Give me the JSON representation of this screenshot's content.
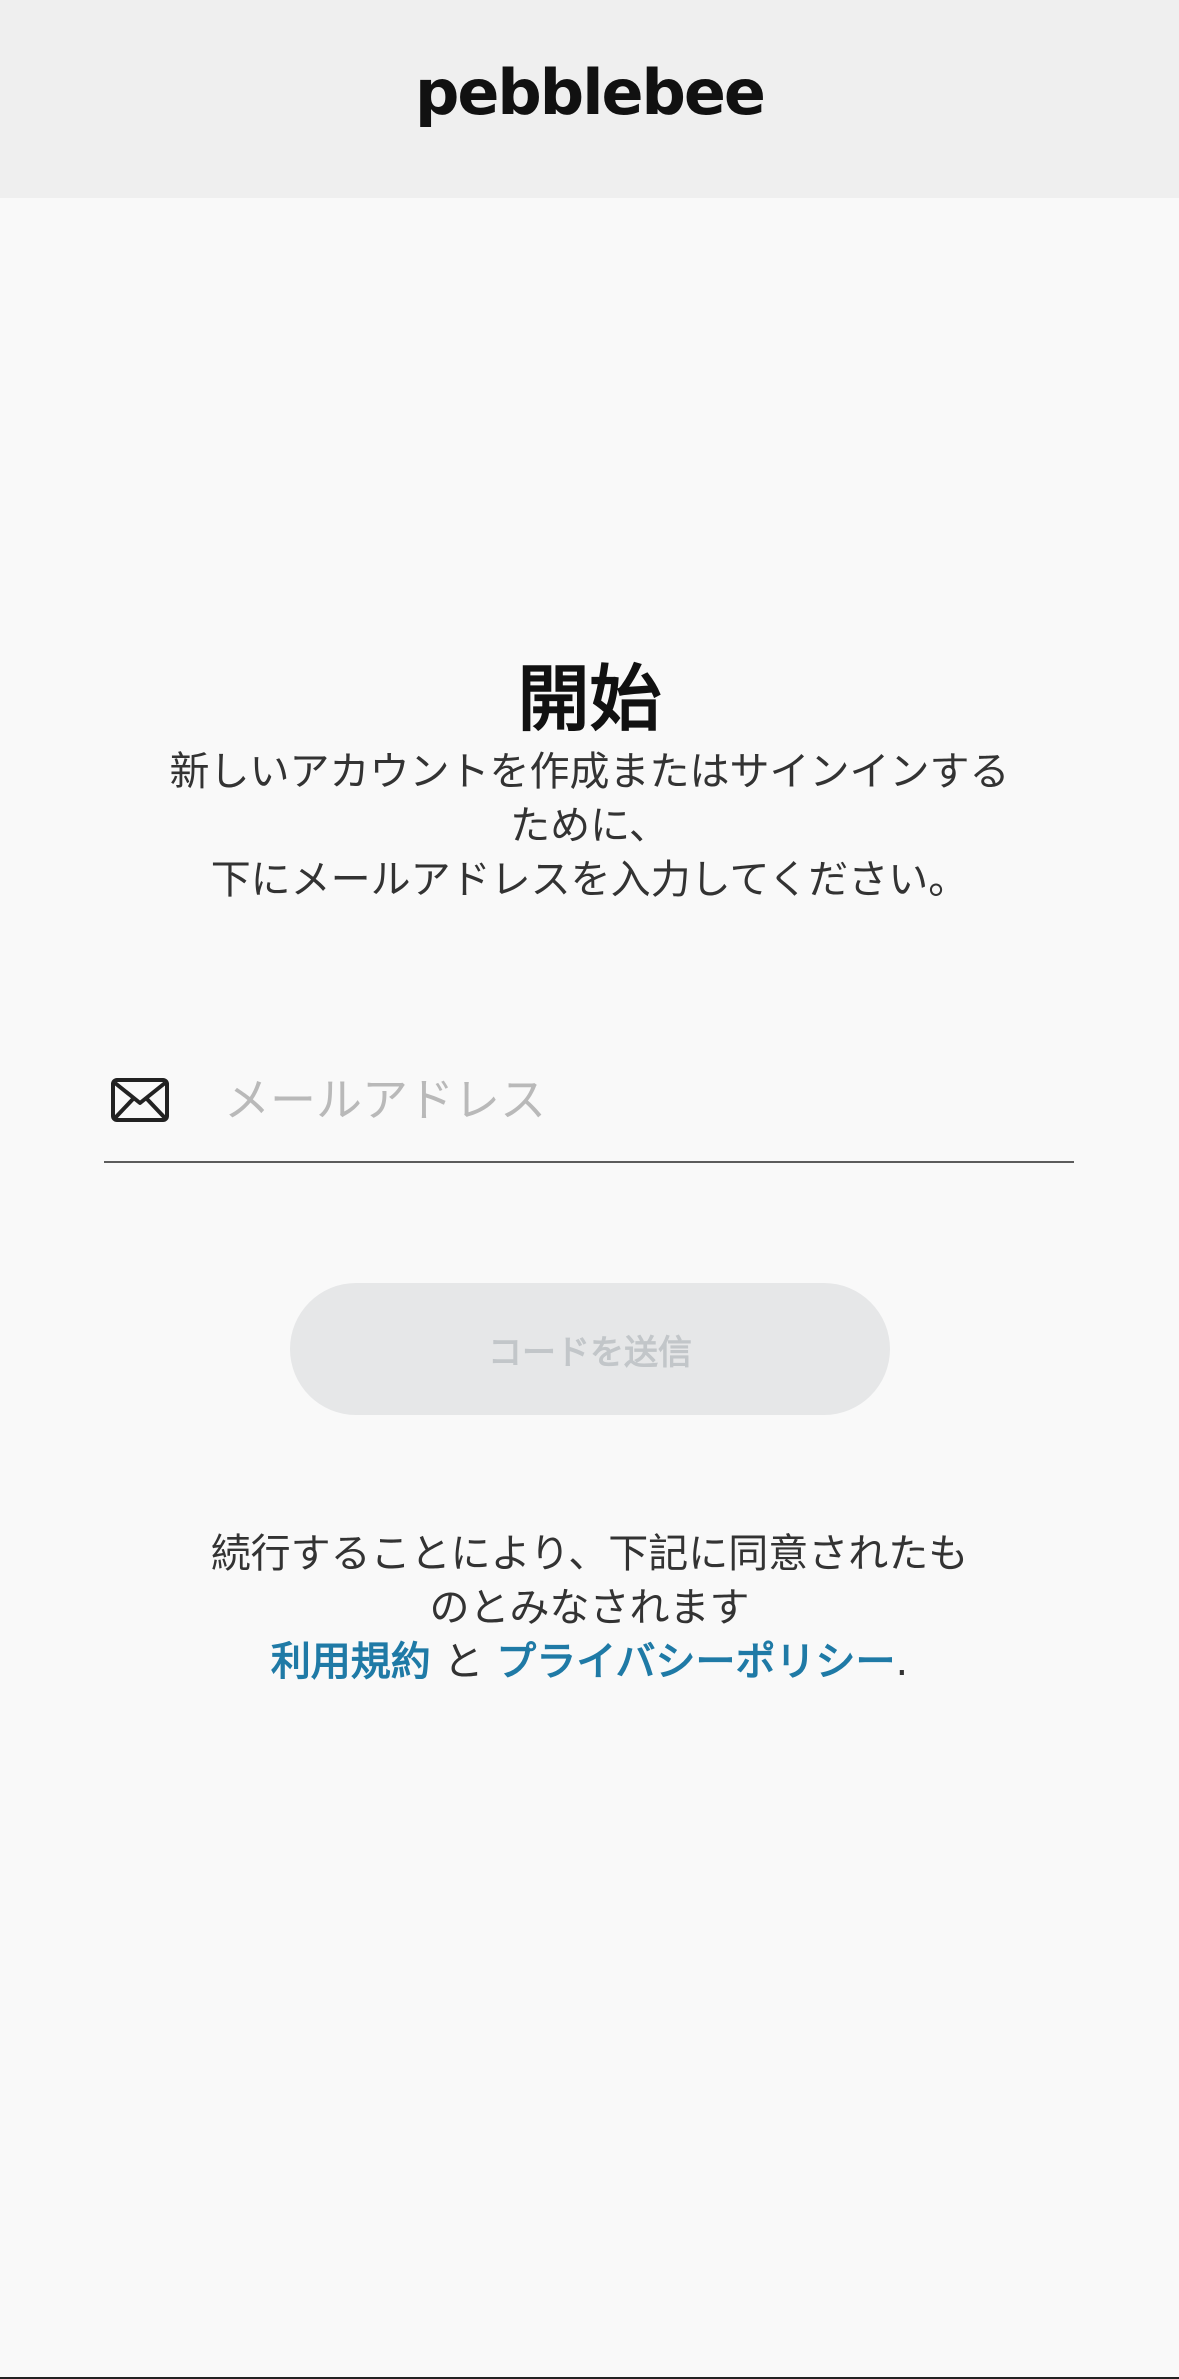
{
  "header": {
    "logo": "pebblebee"
  },
  "main": {
    "title": "開始",
    "subtitle_line1": "新しいアカウントを作成またはサインインする",
    "subtitle_line2": "ために、",
    "subtitle_line3": "下にメールアドレスを入力してください。"
  },
  "email": {
    "placeholder": "メールアドレス",
    "value": "",
    "icon": "mail-icon"
  },
  "send_button": {
    "label": "コードを送信"
  },
  "terms": {
    "line1": "続行することにより、下記に同意されたも",
    "line2": "のとみなされます",
    "terms_link": "利用規約",
    "and": " と ",
    "privacy_link": "プライバシーポリシー",
    "end": "."
  },
  "colors": {
    "link": "#1f7aa6",
    "button_bg": "#e6e7e8",
    "button_text": "#c2c6c9",
    "header_bg": "#efefef",
    "page_bg": "#f9f9f9"
  }
}
